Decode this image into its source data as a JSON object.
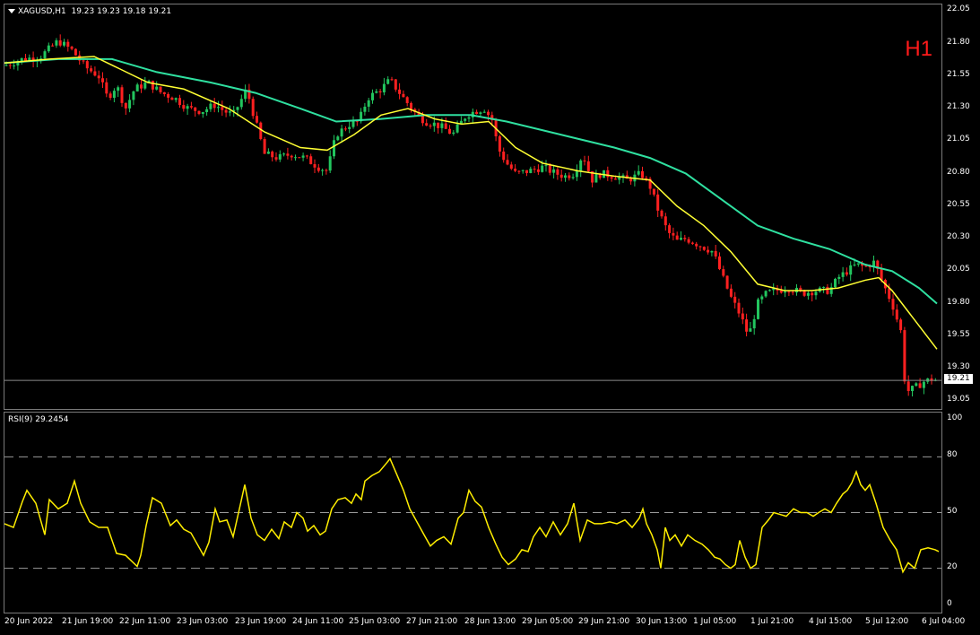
{
  "symbol_header": {
    "symbol": "XAGUSD,H1",
    "ohlc": "19.23 19.23 19.18 19.21"
  },
  "timeframe_label": "H1",
  "rsi_header": {
    "label": "RSI(9) 29.2454"
  },
  "current_price": "19.21",
  "price_axis": {
    "ticks": [
      "22.05",
      "21.80",
      "21.55",
      "21.30",
      "21.05",
      "20.80",
      "20.55",
      "20.30",
      "20.05",
      "19.80",
      "19.55",
      "19.30",
      "19.05"
    ]
  },
  "rsi_axis": {
    "ticks": [
      "100",
      "80",
      "50",
      "20",
      "0"
    ],
    "levels": [
      80,
      50,
      20
    ]
  },
  "time_axis": {
    "labels": [
      "20 Jun 2022",
      "21 Jun 19:00",
      "22 Jun 11:00",
      "23 Jun 03:00",
      "23 Jun 19:00",
      "24 Jun 11:00",
      "25 Jun 03:00",
      "27 Jun 21:00",
      "28 Jun 13:00",
      "29 Jun 05:00",
      "29 Jun 21:00",
      "30 Jun 13:00",
      "1 Jul 05:00",
      "1 Jul 21:00",
      "4 Jul 15:00",
      "5 Jul 12:00",
      "6 Jul 04:00"
    ]
  },
  "colors": {
    "bull": "#22c55e",
    "bear": "#ff2020",
    "ma_fast": "#ffff33",
    "ma_slow": "#2fe0a0",
    "rsi": "#ffee00",
    "background": "#000000",
    "grid": "#7a7a7a"
  },
  "chart_data": {
    "type": "candlestick",
    "price_ylim": [
      18.99,
      22.1
    ],
    "close_path": [
      [
        0,
        21.63
      ],
      [
        20,
        21.68
      ],
      [
        40,
        21.7
      ],
      [
        60,
        21.82
      ],
      [
        75,
        21.75
      ],
      [
        90,
        21.62
      ],
      [
        105,
        21.55
      ],
      [
        115,
        21.38
      ],
      [
        125,
        21.48
      ],
      [
        135,
        21.3
      ],
      [
        145,
        21.45
      ],
      [
        160,
        21.5
      ],
      [
        175,
        21.42
      ],
      [
        190,
        21.38
      ],
      [
        205,
        21.3
      ],
      [
        220,
        21.28
      ],
      [
        235,
        21.33
      ],
      [
        245,
        21.28
      ],
      [
        255,
        21.25
      ],
      [
        265,
        21.38
      ],
      [
        270,
        21.45
      ],
      [
        280,
        21.2
      ],
      [
        290,
        20.95
      ],
      [
        305,
        20.92
      ],
      [
        320,
        20.95
      ],
      [
        335,
        20.92
      ],
      [
        350,
        20.85
      ],
      [
        360,
        20.82
      ],
      [
        370,
        21.1
      ],
      [
        385,
        21.18
      ],
      [
        395,
        21.2
      ],
      [
        405,
        21.38
      ],
      [
        420,
        21.45
      ],
      [
        430,
        21.52
      ],
      [
        445,
        21.38
      ],
      [
        460,
        21.25
      ],
      [
        470,
        21.2
      ],
      [
        480,
        21.18
      ],
      [
        490,
        21.15
      ],
      [
        500,
        21.1
      ],
      [
        515,
        21.25
      ],
      [
        525,
        21.28
      ],
      [
        535,
        21.3
      ],
      [
        545,
        21.2
      ],
      [
        550,
        21.0
      ],
      [
        560,
        20.88
      ],
      [
        570,
        20.8
      ],
      [
        585,
        20.82
      ],
      [
        600,
        20.85
      ],
      [
        615,
        20.8
      ],
      [
        625,
        20.78
      ],
      [
        635,
        20.8
      ],
      [
        645,
        20.95
      ],
      [
        655,
        20.75
      ],
      [
        665,
        20.8
      ],
      [
        680,
        20.78
      ],
      [
        695,
        20.75
      ],
      [
        710,
        20.8
      ],
      [
        720,
        20.7
      ],
      [
        730,
        20.5
      ],
      [
        740,
        20.35
      ],
      [
        750,
        20.28
      ],
      [
        760,
        20.3
      ],
      [
        775,
        20.25
      ],
      [
        790,
        20.2
      ],
      [
        800,
        20.02
      ],
      [
        810,
        19.85
      ],
      [
        820,
        19.72
      ],
      [
        830,
        19.55
      ],
      [
        840,
        19.8
      ],
      [
        850,
        19.88
      ],
      [
        860,
        19.9
      ],
      [
        875,
        19.92
      ],
      [
        890,
        19.88
      ],
      [
        905,
        19.9
      ],
      [
        920,
        19.9
      ],
      [
        930,
        20.0
      ],
      [
        940,
        20.05
      ],
      [
        950,
        20.1
      ],
      [
        960,
        20.08
      ],
      [
        970,
        20.12
      ],
      [
        980,
        19.95
      ],
      [
        990,
        19.8
      ],
      [
        1000,
        19.58
      ],
      [
        1005,
        19.12
      ],
      [
        1015,
        19.15
      ],
      [
        1025,
        19.2
      ],
      [
        1035,
        19.22
      ],
      [
        1040,
        19.21
      ]
    ],
    "ma_fast": [
      [
        0,
        21.65
      ],
      [
        50,
        21.68
      ],
      [
        100,
        21.7
      ],
      [
        130,
        21.6
      ],
      [
        160,
        21.5
      ],
      [
        200,
        21.45
      ],
      [
        250,
        21.3
      ],
      [
        290,
        21.12
      ],
      [
        330,
        21.0
      ],
      [
        360,
        20.98
      ],
      [
        390,
        21.1
      ],
      [
        420,
        21.25
      ],
      [
        450,
        21.3
      ],
      [
        480,
        21.22
      ],
      [
        510,
        21.18
      ],
      [
        540,
        21.2
      ],
      [
        570,
        21.0
      ],
      [
        600,
        20.88
      ],
      [
        640,
        20.82
      ],
      [
        680,
        20.78
      ],
      [
        720,
        20.75
      ],
      [
        750,
        20.55
      ],
      [
        780,
        20.4
      ],
      [
        810,
        20.2
      ],
      [
        840,
        19.95
      ],
      [
        870,
        19.9
      ],
      [
        900,
        19.9
      ],
      [
        930,
        19.92
      ],
      [
        960,
        19.98
      ],
      [
        975,
        20.0
      ],
      [
        990,
        19.9
      ],
      [
        1010,
        19.72
      ],
      [
        1040,
        19.45
      ]
    ],
    "ma_slow": [
      [
        0,
        21.65
      ],
      [
        60,
        21.68
      ],
      [
        120,
        21.68
      ],
      [
        170,
        21.58
      ],
      [
        230,
        21.5
      ],
      [
        280,
        21.42
      ],
      [
        330,
        21.3
      ],
      [
        370,
        21.2
      ],
      [
        420,
        21.22
      ],
      [
        470,
        21.25
      ],
      [
        520,
        21.25
      ],
      [
        560,
        21.2
      ],
      [
        620,
        21.1
      ],
      [
        680,
        21.0
      ],
      [
        720,
        20.92
      ],
      [
        760,
        20.8
      ],
      [
        800,
        20.6
      ],
      [
        840,
        20.4
      ],
      [
        880,
        20.3
      ],
      [
        920,
        20.22
      ],
      [
        960,
        20.1
      ],
      [
        990,
        20.05
      ],
      [
        1020,
        19.92
      ],
      [
        1040,
        19.8
      ]
    ],
    "rsi_ylim": [
      0,
      100
    ],
    "rsi": [
      [
        0,
        44
      ],
      [
        10,
        42
      ],
      [
        20,
        56
      ],
      [
        25,
        62
      ],
      [
        35,
        55
      ],
      [
        45,
        38
      ],
      [
        50,
        57
      ],
      [
        60,
        52
      ],
      [
        70,
        55
      ],
      [
        78,
        67
      ],
      [
        85,
        55
      ],
      [
        95,
        45
      ],
      [
        105,
        42
      ],
      [
        115,
        42
      ],
      [
        125,
        28
      ],
      [
        135,
        27
      ],
      [
        148,
        21
      ],
      [
        152,
        27
      ],
      [
        158,
        43
      ],
      [
        165,
        58
      ],
      [
        175,
        55
      ],
      [
        185,
        43
      ],
      [
        192,
        46
      ],
      [
        200,
        41
      ],
      [
        208,
        39
      ],
      [
        215,
        33
      ],
      [
        222,
        27
      ],
      [
        228,
        34
      ],
      [
        235,
        52
      ],
      [
        240,
        45
      ],
      [
        248,
        46
      ],
      [
        255,
        37
      ],
      [
        262,
        52
      ],
      [
        268,
        65
      ],
      [
        275,
        47
      ],
      [
        282,
        38
      ],
      [
        290,
        35
      ],
      [
        298,
        41
      ],
      [
        306,
        36
      ],
      [
        312,
        45
      ],
      [
        320,
        42
      ],
      [
        326,
        50
      ],
      [
        333,
        47
      ],
      [
        338,
        40
      ],
      [
        345,
        43
      ],
      [
        352,
        38
      ],
      [
        358,
        40
      ],
      [
        365,
        52
      ],
      [
        372,
        57
      ],
      [
        380,
        58
      ],
      [
        387,
        55
      ],
      [
        392,
        60
      ],
      [
        398,
        57
      ],
      [
        402,
        67
      ],
      [
        410,
        70
      ],
      [
        418,
        72
      ],
      [
        425,
        76
      ],
      [
        430,
        79
      ],
      [
        438,
        70
      ],
      [
        445,
        62
      ],
      [
        452,
        52
      ],
      [
        460,
        45
      ],
      [
        468,
        38
      ],
      [
        475,
        32
      ],
      [
        482,
        35
      ],
      [
        490,
        37
      ],
      [
        498,
        33
      ],
      [
        506,
        47
      ],
      [
        512,
        50
      ],
      [
        518,
        62
      ],
      [
        525,
        56
      ],
      [
        532,
        53
      ],
      [
        540,
        42
      ],
      [
        548,
        33
      ],
      [
        555,
        26
      ],
      [
        562,
        22
      ],
      [
        570,
        25
      ],
      [
        577,
        30
      ],
      [
        584,
        29
      ],
      [
        590,
        37
      ],
      [
        597,
        42
      ],
      [
        604,
        37
      ],
      [
        612,
        45
      ],
      [
        620,
        38
      ],
      [
        628,
        44
      ],
      [
        635,
        55
      ],
      [
        642,
        35
      ],
      [
        650,
        46
      ],
      [
        658,
        44
      ],
      [
        666,
        44
      ],
      [
        675,
        45
      ],
      [
        683,
        44
      ],
      [
        692,
        46
      ],
      [
        700,
        42
      ],
      [
        708,
        47
      ],
      [
        712,
        52
      ],
      [
        716,
        44
      ],
      [
        722,
        38
      ],
      [
        728,
        30
      ],
      [
        732,
        20
      ],
      [
        737,
        42
      ],
      [
        742,
        35
      ],
      [
        748,
        38
      ],
      [
        755,
        32
      ],
      [
        762,
        38
      ],
      [
        770,
        35
      ],
      [
        778,
        33
      ],
      [
        785,
        30
      ],
      [
        792,
        26
      ],
      [
        798,
        25
      ],
      [
        804,
        22
      ],
      [
        810,
        20
      ],
      [
        815,
        22
      ],
      [
        820,
        35
      ],
      [
        826,
        26
      ],
      [
        832,
        20
      ],
      [
        838,
        22
      ],
      [
        845,
        42
      ],
      [
        852,
        46
      ],
      [
        858,
        50
      ],
      [
        865,
        49
      ],
      [
        872,
        48
      ],
      [
        880,
        52
      ],
      [
        888,
        50
      ],
      [
        895,
        50
      ],
      [
        902,
        48
      ],
      [
        908,
        50
      ],
      [
        915,
        52
      ],
      [
        922,
        50
      ],
      [
        928,
        55
      ],
      [
        935,
        60
      ],
      [
        940,
        62
      ],
      [
        945,
        66
      ],
      [
        950,
        72
      ],
      [
        955,
        65
      ],
      [
        960,
        62
      ],
      [
        965,
        65
      ],
      [
        972,
        55
      ],
      [
        980,
        42
      ],
      [
        988,
        35
      ],
      [
        995,
        30
      ],
      [
        1002,
        18
      ],
      [
        1008,
        23
      ],
      [
        1015,
        20
      ],
      [
        1022,
        30
      ],
      [
        1030,
        31
      ],
      [
        1038,
        30
      ],
      [
        1042,
        29
      ]
    ]
  }
}
